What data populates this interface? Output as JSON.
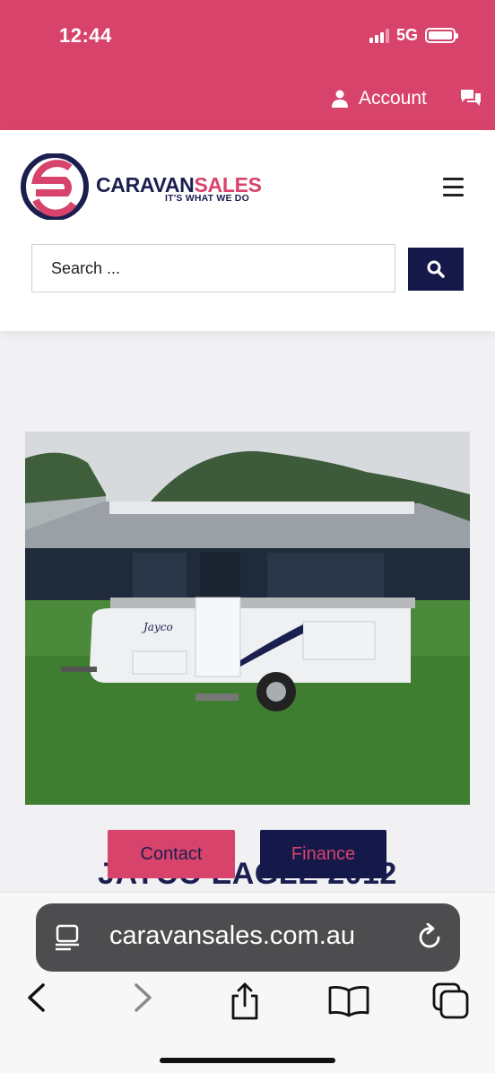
{
  "status": {
    "time": "12:44",
    "network": "5G"
  },
  "topbar": {
    "account_label": "Account",
    "icons": [
      "user-icon",
      "chat-icon"
    ]
  },
  "header": {
    "brand_part1": "CARAVAN",
    "brand_part2": "SALES",
    "tagline": "IT'S WHAT WE DO",
    "search": {
      "placeholder": "Search ...",
      "value": ""
    },
    "icons": [
      "hamburger-menu-icon",
      "search-icon"
    ]
  },
  "listing": {
    "title": "JAYCO EAGLE 2012",
    "image_badge": "Jayco",
    "contact_label": "Contact",
    "finance_label": "Finance"
  },
  "browser": {
    "url": "caravansales.com.au",
    "icons": [
      "reader-icon",
      "reload-icon",
      "back-icon",
      "forward-icon",
      "share-icon",
      "bookmarks-icon",
      "tabs-icon"
    ]
  },
  "colors": {
    "accent": "#d8436b",
    "brand_navy": "#15194a"
  }
}
